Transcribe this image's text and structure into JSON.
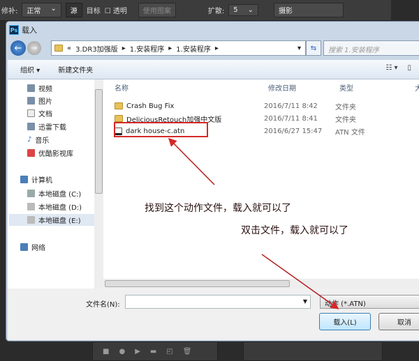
{
  "ps_toolbar": {
    "repair_label": "修补:",
    "repair_value": "正常",
    "source": "源",
    "target": "目标",
    "transparent": "透明",
    "use_pattern": "使用图案",
    "diffusion_label": "扩散:",
    "diffusion_value": "5",
    "mode": "摄影"
  },
  "dialog": {
    "title": "载入",
    "app_icon": "Ps",
    "breadcrumb": [
      "«",
      "3.DR3加强版",
      "1.安装程序",
      "1.安装程序"
    ],
    "search_placeholder": "搜索 1.安装程序",
    "toolbar": {
      "organize": "组织 ▾",
      "new_folder": "新建文件夹"
    },
    "sidebar": [
      {
        "label": "视频"
      },
      {
        "label": "图片"
      },
      {
        "label": "文档"
      },
      {
        "label": "迅雷下载"
      },
      {
        "label": "音乐"
      },
      {
        "label": "优酷影视库"
      },
      {
        "label": "计算机"
      },
      {
        "label": "本地磁盘 (C:)"
      },
      {
        "label": "本地磁盘 (D:)"
      },
      {
        "label": "本地磁盘 (E:)"
      },
      {
        "label": "网络"
      }
    ],
    "columns": {
      "name": "名称",
      "date": "修改日期",
      "type": "类型",
      "size": "大"
    },
    "files": [
      {
        "name": "Crash Bug Fix",
        "date": "2016/7/11 8:42",
        "type": "文件夹"
      },
      {
        "name": "DeliciousRetouch加强中文版",
        "date": "2016/7/11 8:41",
        "type": "文件夹"
      },
      {
        "name": "dark house-c.atn",
        "date": "2016/6/27 15:47",
        "type": "ATN 文件"
      }
    ],
    "filename_label": "文件名(N):",
    "filename_value": "",
    "filetype": "动作 (*.ATN)",
    "load_button": "载入(L)",
    "cancel_button": "取消"
  },
  "annotations": {
    "note1": "找到这个动作文件，载入就可以了",
    "note2": "双击文件，载入就可以了"
  },
  "colors": {
    "annotation_red": "#d52828"
  }
}
